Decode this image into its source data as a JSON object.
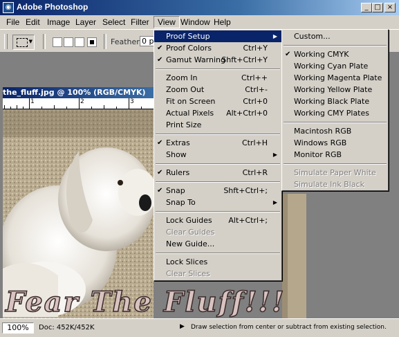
{
  "window": {
    "title": "Adobe Photoshop",
    "app_icon": "photoshop-eye-icon",
    "controls": {
      "minimize": "_",
      "maximize": "□",
      "close": "×"
    }
  },
  "menubar": [
    "File",
    "Edit",
    "Image",
    "Layer",
    "Select",
    "Filter",
    "View",
    "Window",
    "Help"
  ],
  "options_bar": {
    "feather_label": "Feather:",
    "feather_value": "0 p"
  },
  "document": {
    "title": "the_fluff.jpg @ 100% (RGB/CMYK)",
    "ruler_labels": [
      "1",
      "2",
      "3"
    ],
    "caption": "Fear The Fluff!!!"
  },
  "view_menu": [
    {
      "label": "Proof Setup",
      "shortcut": "",
      "checked": false,
      "submenu": true,
      "highlighted": true
    },
    {
      "label": "Proof Colors",
      "shortcut": "Ctrl+Y",
      "checked": true
    },
    {
      "label": "Gamut Warning",
      "shortcut": "Shft+Ctrl+Y",
      "checked": true
    },
    {
      "sep": true
    },
    {
      "label": "Zoom In",
      "shortcut": "Ctrl++"
    },
    {
      "label": "Zoom Out",
      "shortcut": "Ctrl+-"
    },
    {
      "label": "Fit on Screen",
      "shortcut": "Ctrl+0"
    },
    {
      "label": "Actual Pixels",
      "shortcut": "Alt+Ctrl+0"
    },
    {
      "label": "Print Size",
      "shortcut": ""
    },
    {
      "sep": true
    },
    {
      "label": "Extras",
      "shortcut": "Ctrl+H",
      "checked": true
    },
    {
      "label": "Show",
      "shortcut": "",
      "submenu": true
    },
    {
      "sep": true
    },
    {
      "label": "Rulers",
      "shortcut": "Ctrl+R",
      "checked": true
    },
    {
      "sep": true
    },
    {
      "label": "Snap",
      "shortcut": "Shft+Ctrl+;",
      "checked": true
    },
    {
      "label": "Snap To",
      "shortcut": "",
      "submenu": true
    },
    {
      "sep": true
    },
    {
      "label": "Lock Guides",
      "shortcut": "Alt+Ctrl+;"
    },
    {
      "label": "Clear Guides",
      "shortcut": "",
      "disabled": true
    },
    {
      "label": "New Guide...",
      "shortcut": ""
    },
    {
      "sep": true
    },
    {
      "label": "Lock Slices",
      "shortcut": ""
    },
    {
      "label": "Clear Slices",
      "shortcut": "",
      "disabled": true
    }
  ],
  "proof_submenu": [
    {
      "label": "Custom..."
    },
    {
      "sep": true
    },
    {
      "label": "Working CMYK",
      "checked": true
    },
    {
      "label": "Working Cyan Plate"
    },
    {
      "label": "Working Magenta Plate"
    },
    {
      "label": "Working Yellow Plate"
    },
    {
      "label": "Working Black Plate"
    },
    {
      "label": "Working CMY Plates"
    },
    {
      "sep": true
    },
    {
      "label": "Macintosh RGB"
    },
    {
      "label": "Windows RGB"
    },
    {
      "label": "Monitor RGB"
    },
    {
      "sep": true
    },
    {
      "label": "Simulate Paper White",
      "disabled": true
    },
    {
      "label": "Simulate Ink Black",
      "disabled": true
    }
  ],
  "status": {
    "zoom": "100%",
    "doc_size": "Doc: 452K/452K",
    "hint": "Draw selection from center or subtract from existing selection."
  },
  "colors": {
    "title_blue": "#0a246a",
    "menu_highlight": "#0a246a",
    "chrome": "#d4d0c8"
  }
}
